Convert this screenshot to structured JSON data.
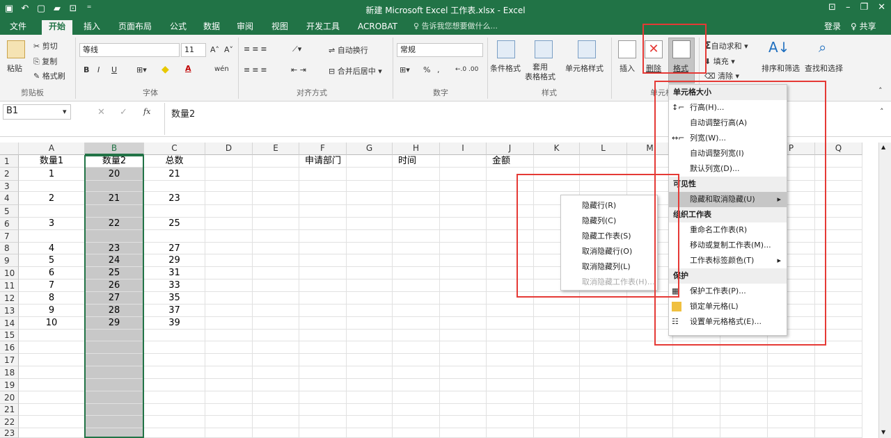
{
  "title": "新建 Microsoft Excel 工作表.xlsx - Excel",
  "qat": [
    "save-icon",
    "undo-icon",
    "new-icon",
    "open-icon",
    "preview-icon",
    "customize-icon"
  ],
  "qat_glyphs": [
    "▣",
    "↶",
    "▢",
    "▰",
    "⊡",
    "⁼"
  ],
  "win_controls": [
    "⊡",
    "–",
    "❐",
    "✕"
  ],
  "tabs": [
    "文件",
    "开始",
    "插入",
    "页面布局",
    "公式",
    "数据",
    "审阅",
    "视图",
    "开发工具",
    "ACROBAT"
  ],
  "tellme": "♀ 告诉我您想要做什么...",
  "signin": "登录",
  "share": "♀ 共享",
  "ribbon": {
    "clipboard": {
      "paste": "粘贴",
      "cut": "剪切",
      "copy": "复制",
      "format_painter": "格式刷",
      "label": "剪贴板"
    },
    "font": {
      "name": "等线",
      "size": "11",
      "label": "字体",
      "bold": "B",
      "italic": "I",
      "underline": "U",
      "grow": "A˄",
      "shrink": "A˅",
      "phonetic": "wén"
    },
    "alignment": {
      "wrap": "自动换行",
      "merge": "合并后居中",
      "label": "对齐方式"
    },
    "number": {
      "format": "常规",
      "percent": "%",
      "comma": ",",
      "inc": "←.0 .00",
      "dec": ".00 →.0",
      "label": "数字"
    },
    "styles": {
      "cond": "条件格式",
      "table": "套用\n表格格式",
      "cellstyle": "单元格样式",
      "label": "样式"
    },
    "cells": {
      "insert": "插入",
      "delete": "删除",
      "format": "格式",
      "label": "单元格"
    },
    "editing": {
      "autosum": "自动求和",
      "fill": "填充",
      "clear": "清除",
      "sort": "排序和筛选",
      "find": "查找和选择"
    }
  },
  "namebox": "B1",
  "fx": "fx",
  "formula": "数量2",
  "columns": [
    "A",
    "B",
    "C",
    "D",
    "E",
    "F",
    "G",
    "H",
    "I",
    "J",
    "K",
    "L",
    "M",
    "N",
    "O",
    "P",
    "Q"
  ],
  "rows": [
    "1",
    "2",
    "3",
    "4",
    "5",
    "6",
    "7",
    "8",
    "9",
    "10",
    "11",
    "12",
    "13",
    "14",
    "15",
    "16",
    "17",
    "18",
    "19",
    "20",
    "21",
    "22",
    "23"
  ],
  "cells": {
    "A": [
      "数量1",
      "1",
      "",
      "2",
      "",
      "3",
      "",
      "4",
      "5",
      "6",
      "7",
      "8",
      "9",
      "10"
    ],
    "B": [
      "数量2",
      "20",
      "",
      "21",
      "",
      "22",
      "",
      "23",
      "24",
      "25",
      "26",
      "27",
      "28",
      "29"
    ],
    "C": [
      "总数",
      "21",
      "",
      "23",
      "",
      "25",
      "",
      "27",
      "29",
      "31",
      "33",
      "35",
      "37",
      "39"
    ],
    "F": [
      "申请部门"
    ],
    "H": [
      "时间"
    ],
    "J": [
      "金额"
    ]
  },
  "format_menu": [
    {
      "type": "header",
      "label": "单元格大小"
    },
    {
      "type": "item",
      "label": "行高(H)...",
      "icon": "row-height-icon"
    },
    {
      "type": "item",
      "label": "自动调整行高(A)"
    },
    {
      "type": "item",
      "label": "列宽(W)...",
      "icon": "col-width-icon"
    },
    {
      "type": "item",
      "label": "自动调整列宽(I)"
    },
    {
      "type": "item",
      "label": "默认列宽(D)..."
    },
    {
      "type": "header",
      "label": "可见性"
    },
    {
      "type": "item",
      "label": "隐藏和取消隐藏(U)",
      "sub": true,
      "hi": true
    },
    {
      "type": "header",
      "label": "组织工作表"
    },
    {
      "type": "item",
      "label": "重命名工作表(R)"
    },
    {
      "type": "item",
      "label": "移动或复制工作表(M)..."
    },
    {
      "type": "item",
      "label": "工作表标签颜色(T)",
      "sub": true
    },
    {
      "type": "header",
      "label": "保护"
    },
    {
      "type": "item",
      "label": "保护工作表(P)...",
      "icon": "protect-icon"
    },
    {
      "type": "item",
      "label": "锁定单元格(L)",
      "icon": "lock-icon"
    },
    {
      "type": "item",
      "label": "设置单元格格式(E)...",
      "icon": "format-cells-icon"
    }
  ],
  "hide_menu": [
    "隐藏行(R)",
    "隐藏列(C)",
    "隐藏工作表(S)",
    "取消隐藏行(O)",
    "取消隐藏列(L)",
    "取消隐藏工作表(H)..."
  ],
  "colors": {
    "excel_green": "#217346",
    "selected": "#c8c8c8",
    "red": "#e53935"
  }
}
